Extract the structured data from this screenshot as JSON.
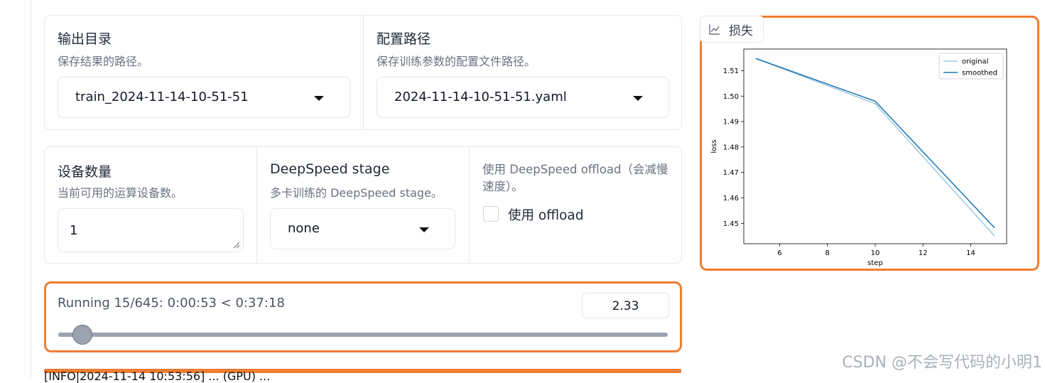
{
  "row1": {
    "output_dir": {
      "label": "输出目录",
      "info": "保存结果的路径。",
      "value": "train_2024-11-14-10-51-51"
    },
    "config_path": {
      "label": "配置路径",
      "info": "保存训练参数的配置文件路径。",
      "value": "2024-11-14-10-51-51.yaml"
    }
  },
  "row2": {
    "device_count": {
      "label": "设备数量",
      "info": "当前可用的运算设备数。",
      "value": "1"
    },
    "ds_stage": {
      "label": "DeepSpeed stage",
      "info": "多卡训练的 DeepSpeed stage。",
      "value": "none"
    },
    "ds_offload": {
      "info_line1": "使用 DeepSpeed offload（会减慢",
      "info_line2": "速度）。",
      "checkbox_label": "使用 offload"
    }
  },
  "progress": {
    "text": "Running 15/645: 0:00:53 < 0:37:18",
    "fraction": 0.0233,
    "value": "2.33"
  },
  "loss_panel": {
    "tab_label": "损失",
    "tab_icon": "chart-icon"
  },
  "watermark": "CSDN @不会写代码的小明1",
  "log_text": "[INFO|2024-11-14 10:53:56] ... (GPU) ...",
  "colors": {
    "accent": "#ed7d31",
    "original": "#9ecae1",
    "smoothed": "#1f77b4"
  },
  "chart_data": {
    "type": "line",
    "xlabel": "step",
    "ylabel": "loss",
    "xlim": [
      4.5,
      15.5
    ],
    "ylim": [
      1.442,
      1.5185
    ],
    "xticks": [
      6,
      8,
      10,
      12,
      14
    ],
    "yticks": [
      1.45,
      1.46,
      1.47,
      1.48,
      1.49,
      1.5,
      1.51
    ],
    "legend": "top-right",
    "series": [
      {
        "name": "original",
        "color": "#9ecae1",
        "x": [
          5,
          10,
          15
        ],
        "y": [
          1.5148,
          1.497,
          1.445
        ]
      },
      {
        "name": "smoothed",
        "color": "#1f77b4",
        "x": [
          5,
          10,
          15
        ],
        "y": [
          1.5148,
          1.498,
          1.4482
        ]
      }
    ]
  }
}
